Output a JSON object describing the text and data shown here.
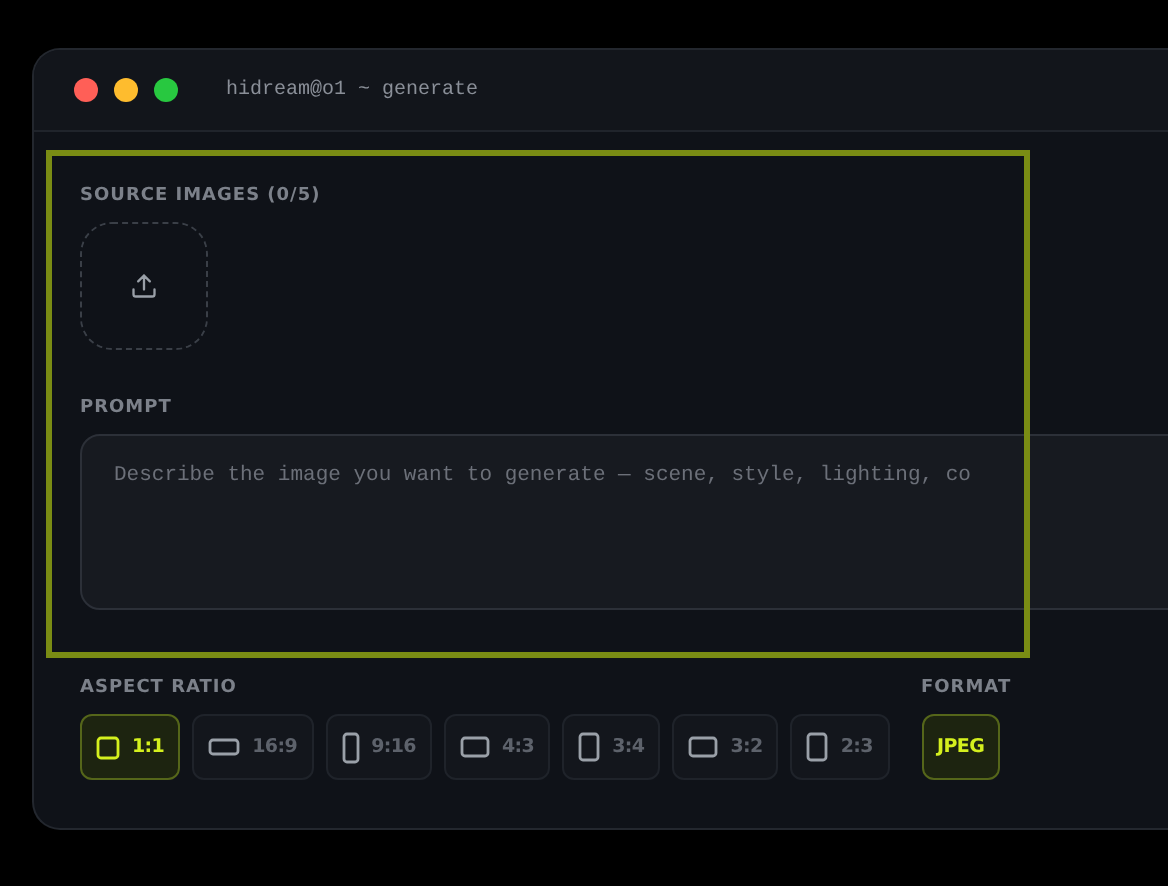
{
  "window": {
    "title": "hidream@o1 ~ generate"
  },
  "source_images": {
    "label": "SOURCE IMAGES (0/5)"
  },
  "prompt": {
    "label": "PROMPT",
    "placeholder": "Describe the image you want to generate — scene, style, lighting, co"
  },
  "aspect_ratio": {
    "label": "ASPECT RATIO",
    "options": [
      {
        "label": "1:1",
        "kind": "square",
        "selected": true
      },
      {
        "label": "16:9",
        "kind": "wide",
        "selected": false
      },
      {
        "label": "9:16",
        "kind": "tall",
        "selected": false
      },
      {
        "label": "4:3",
        "kind": "landscape",
        "selected": false
      },
      {
        "label": "3:4",
        "kind": "portrait",
        "selected": false
      },
      {
        "label": "3:2",
        "kind": "landscape",
        "selected": false
      },
      {
        "label": "2:3",
        "kind": "portrait",
        "selected": false
      }
    ]
  },
  "format": {
    "label": "FORMAT",
    "options": [
      {
        "label": "JPEG",
        "selected": true
      }
    ]
  }
}
